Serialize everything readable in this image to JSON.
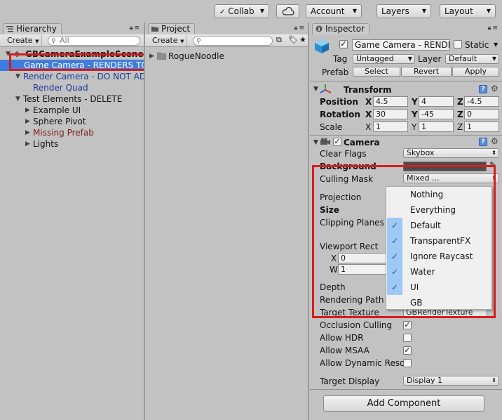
{
  "toolbar": {
    "collab": "Collab",
    "account": "Account",
    "layers": "Layers",
    "layout": "Layout"
  },
  "hierarchy": {
    "tab": "Hierarchy",
    "create": "Create",
    "search_placeholder": "All",
    "items": [
      {
        "label": "GBCameraExampleScene"
      },
      {
        "label": "Game Camera - RENDERS TO"
      },
      {
        "label": "Render Camera - DO NOT ADD"
      },
      {
        "label": "Render Quad"
      },
      {
        "label": "Test Elements - DELETE"
      },
      {
        "label": "Example UI"
      },
      {
        "label": "Sphere Pivot"
      },
      {
        "label": "Missing Prefab"
      },
      {
        "label": "Lights"
      }
    ]
  },
  "project": {
    "tab": "Project",
    "create": "Create",
    "folder": "RogueNoodle"
  },
  "inspector": {
    "tab": "Inspector",
    "object_name": "Game Camera - RENDE",
    "static_label": "Static",
    "tag_label": "Tag",
    "tag_value": "Untagged",
    "layer_label": "Layer",
    "layer_value": "Default",
    "prefab_label": "Prefab",
    "prefab_select": "Select",
    "prefab_revert": "Revert",
    "prefab_apply": "Apply",
    "transform": {
      "title": "Transform",
      "position_label": "Position",
      "rotation_label": "Rotation",
      "scale_label": "Scale",
      "x": "X",
      "y": "Y",
      "z": "Z",
      "position": [
        "4.5",
        "4",
        "-4.5"
      ],
      "rotation": [
        "30",
        "-45",
        "0"
      ],
      "scale": [
        "1",
        "1",
        "1"
      ]
    },
    "camera": {
      "title": "Camera",
      "clear_flags_label": "Clear Flags",
      "clear_flags_value": "Skybox",
      "background_label": "Background",
      "culling_mask_label": "Culling Mask",
      "culling_mask_value": "Mixed ...",
      "projection_label": "Projection",
      "size_label": "Size",
      "clipping_label": "Clipping Planes",
      "viewport_label": "Viewport Rect",
      "viewport_x_label": "X",
      "viewport_x_value": "0",
      "viewport_w_label": "W",
      "viewport_w_value": "1",
      "depth_label": "Depth",
      "rendering_path_label": "Rendering Path",
      "target_texture_label": "Target Texture",
      "target_texture_value": "GBRenderTexture",
      "occlusion_label": "Occlusion Culling",
      "hdr_label": "Allow HDR",
      "msaa_label": "Allow MSAA",
      "dynamic_label": "Allow Dynamic Reso",
      "target_display_label": "Target Display",
      "target_display_value": "Display 1"
    },
    "add_component": "Add Component"
  },
  "culling_menu": {
    "items": [
      {
        "label": "Nothing",
        "checked": false
      },
      {
        "label": "Everything",
        "checked": false
      },
      {
        "label": "Default",
        "checked": true
      },
      {
        "label": "TransparentFX",
        "checked": true
      },
      {
        "label": "Ignore Raycast",
        "checked": true
      },
      {
        "label": "Water",
        "checked": true
      },
      {
        "label": "UI",
        "checked": true
      },
      {
        "label": "GB",
        "checked": false
      }
    ]
  },
  "colors": {
    "selection": "#3e7ce0",
    "highlight_box": "#d61d1d",
    "menu_check": "#9ec8f5",
    "prefab_text": "#1a3c9a"
  },
  "icons": {
    "cloud": "cloud-icon",
    "lock": "lock-icon",
    "menu": "panel-menu-icon",
    "gear": "gear-icon",
    "help": "help-icon"
  }
}
